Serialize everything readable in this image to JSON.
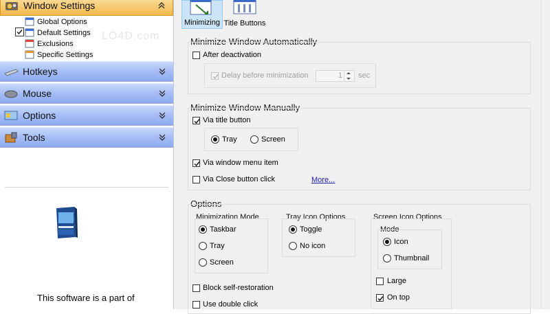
{
  "sidebar": {
    "groups": [
      {
        "label": "Window Settings",
        "icon": "gear-icon"
      },
      {
        "label": "Hotkeys",
        "icon": "keyboard-icon"
      },
      {
        "label": "Mouse",
        "icon": "mouse-icon"
      },
      {
        "label": "Options",
        "icon": "options-icon"
      },
      {
        "label": "Tools",
        "icon": "tools-icon"
      }
    ],
    "tree": [
      {
        "label": "Global Options",
        "checked": false
      },
      {
        "label": "Default Settings",
        "checked": true
      },
      {
        "label": "Exclusions"
      },
      {
        "label": "Specific Settings"
      }
    ],
    "promo_text": "This software is a part of",
    "watermark": "LO4D.com"
  },
  "toolbar": {
    "buttons": [
      {
        "label": "Minimizing",
        "selected": true,
        "icon": "minimize-window-icon"
      },
      {
        "label": "Title Buttons",
        "selected": false,
        "icon": "title-buttons-icon"
      }
    ]
  },
  "sections": {
    "auto": {
      "title": "Minimize Window Automatically",
      "after_deactivation": {
        "label": "After deactivation",
        "checked": false
      },
      "delay": {
        "label": "Delay before minimization",
        "checked": true,
        "enabled": false,
        "value": "1",
        "unit": "sec"
      }
    },
    "manual": {
      "title": "Minimize Window Manually",
      "via_title_button": {
        "label": "Via title button",
        "checked": true
      },
      "target": {
        "options": [
          "Tray",
          "Screen"
        ],
        "selected": "Tray"
      },
      "via_window_menu": {
        "label": "Via window menu item",
        "checked": true
      },
      "via_close_button": {
        "label": "Via Close button click",
        "checked": false
      },
      "more_link": "More..."
    },
    "options": {
      "title": "Options",
      "minimization_mode": {
        "title": "Minimization Mode",
        "options": [
          "Taskbar",
          "Tray",
          "Screen"
        ],
        "selected": "Taskbar"
      },
      "tray_icon": {
        "title": "Tray Icon Options",
        "options": [
          "Toggle",
          "No icon"
        ],
        "selected": "Toggle"
      },
      "screen_icon": {
        "title": "Screen Icon Options",
        "mode_title": "Mode",
        "mode_options": [
          "Icon",
          "Thumbnail"
        ],
        "mode_selected": "Icon",
        "large": {
          "label": "Large",
          "checked": false
        },
        "on_top": {
          "label": "On top",
          "checked": true
        }
      },
      "block_self_restoration": {
        "label": "Block self-restoration",
        "checked": false
      },
      "use_double_click": {
        "label": "Use double click",
        "checked": false
      }
    }
  },
  "colors": {
    "accent_orange": "#f3ba4f",
    "accent_blue": "#a4bdf5",
    "link": "#1a1aa6"
  }
}
